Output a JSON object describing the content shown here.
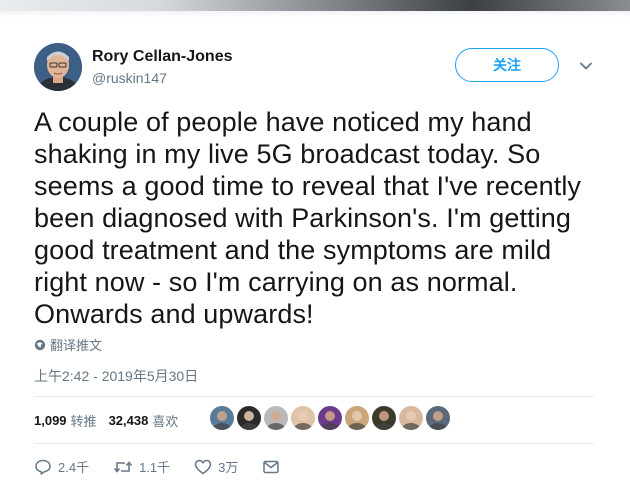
{
  "tweet": {
    "author_name": "Rory Cellan-Jones",
    "author_handle": "@ruskin147",
    "follow_label": "关注",
    "text": "A couple of people have noticed my hand shaking in my live 5G broadcast today. So seems a good time to reveal that I've recently been diagnosed with Parkinson's. I'm getting good treatment and the symptoms are mild right now - so I'm carrying on as normal. Onwards and upwards!",
    "translate_label": "翻译推文",
    "timestamp": "上午2:42 - 2019年5月30日"
  },
  "stats": {
    "retweets_count": "1,099",
    "retweets_label": "转推",
    "likes_count": "32,438",
    "likes_label": "喜欢"
  },
  "liker_avatars": [
    {
      "color": "#5a7a9a"
    },
    {
      "color": "#2b2b2b"
    },
    {
      "color": "#b9b9b9"
    },
    {
      "color": "#e1c3a8"
    },
    {
      "color": "#6b3a8a"
    },
    {
      "color": "#c9a77a"
    },
    {
      "color": "#3a3a2a"
    },
    {
      "color": "#d8b9a0"
    },
    {
      "color": "#5a6a7a"
    }
  ],
  "actions": {
    "reply_count": "2.4千",
    "retweet_count": "1.1千",
    "like_count": "3万"
  },
  "colors": {
    "accent": "#1da1f2",
    "text": "#14171a",
    "secondary": "#657786",
    "divider": "#e6ecf0"
  },
  "icons": {
    "chevron": "chevron-down-icon",
    "globe": "globe-icon",
    "reply": "reply-icon",
    "retweet": "retweet-icon",
    "like": "heart-icon",
    "message": "envelope-icon"
  }
}
